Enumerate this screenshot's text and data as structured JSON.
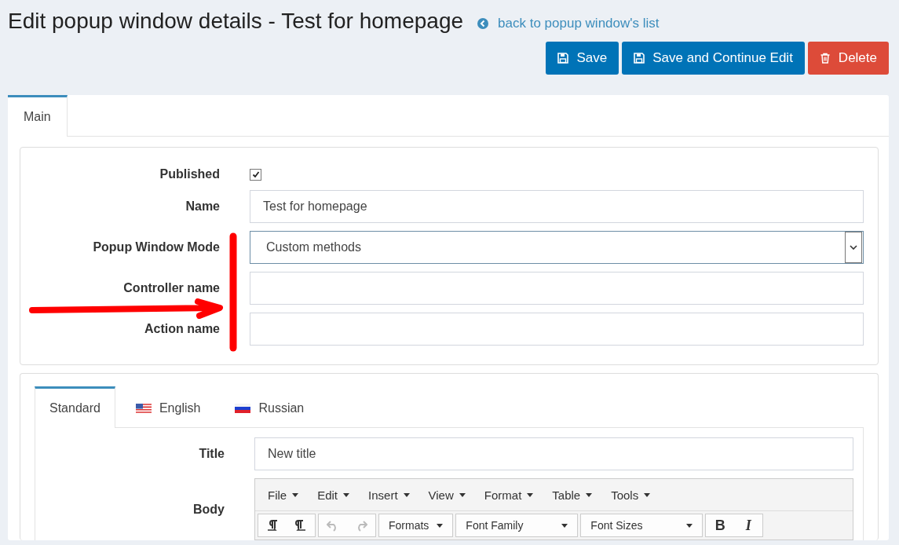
{
  "page": {
    "title": "Edit popup window details - Test for homepage",
    "back_link": "back to popup window's list"
  },
  "buttons": [
    {
      "kind": "save",
      "label": "Save"
    },
    {
      "kind": "save",
      "label": "Save and Continue Edit"
    },
    {
      "kind": "delete",
      "label": "Delete"
    }
  ],
  "tabs": [
    {
      "label": "Main",
      "selected": true
    }
  ],
  "fields": [
    {
      "kind": "checkbox",
      "label": "Published",
      "checked": true
    },
    {
      "kind": "text",
      "label": "Name",
      "value": "Test for homepage"
    },
    {
      "kind": "select",
      "label": "Popup Window Mode",
      "value": "Custom methods"
    },
    {
      "kind": "text",
      "label": "Controller name"
    },
    {
      "kind": "text",
      "label": "Action name"
    }
  ],
  "language_tabs": [
    {
      "label": "Standard",
      "kind": "plain",
      "selected": true
    },
    {
      "label": "English",
      "kind": "flag_us",
      "selected": false
    },
    {
      "label": "Russian",
      "kind": "flag_ru",
      "selected": false
    }
  ],
  "title_field": {
    "label": "Title",
    "value": "New title"
  },
  "body": {
    "label": "Body",
    "menu": [
      "File",
      "Edit",
      "Insert",
      "View",
      "Format",
      "Table",
      "Tools"
    ],
    "dropdowns": [
      "Formats",
      "Font Family",
      "Font Sizes"
    ],
    "format_buttons": [
      "B",
      "I"
    ]
  }
}
